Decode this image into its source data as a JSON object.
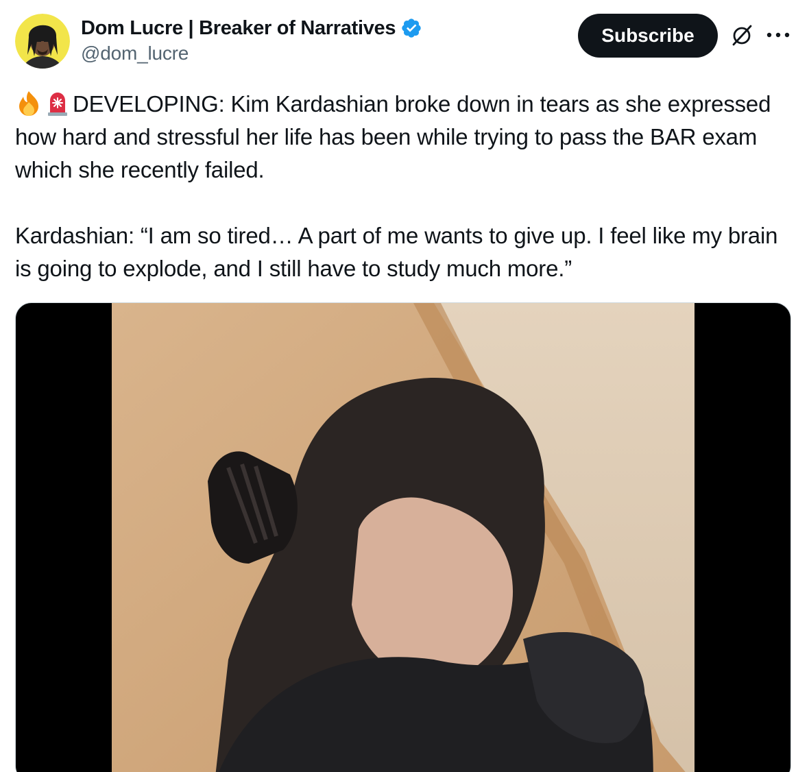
{
  "author": {
    "display_name": "Dom Lucre | Breaker of Narratives",
    "handle": "@dom_lucre",
    "verified": true,
    "avatar_icon": "avatar-portrait"
  },
  "actions": {
    "subscribe_label": "Subscribe",
    "grok_icon": "grok-icon",
    "more_icon": "more-icon"
  },
  "tweet": {
    "lead_emojis": [
      "fire-emoji",
      "siren-emoji"
    ],
    "line1": "DEVELOPING: Kim Kardashian broke down in tears as she expressed how hard and stressful her life has been while trying to pass the BAR exam which she recently failed.",
    "line2": "Kardashian: “I am so tired… A part of me wants to give up. I feel like my brain is going to explode, and I still have to study much more.”"
  },
  "media": {
    "type": "video"
  },
  "colors": {
    "primary_text": "#0f1419",
    "secondary_text": "#536471",
    "verified_blue": "#1d9bf0",
    "button_bg": "#0f1419",
    "border": "#cfd9de"
  }
}
